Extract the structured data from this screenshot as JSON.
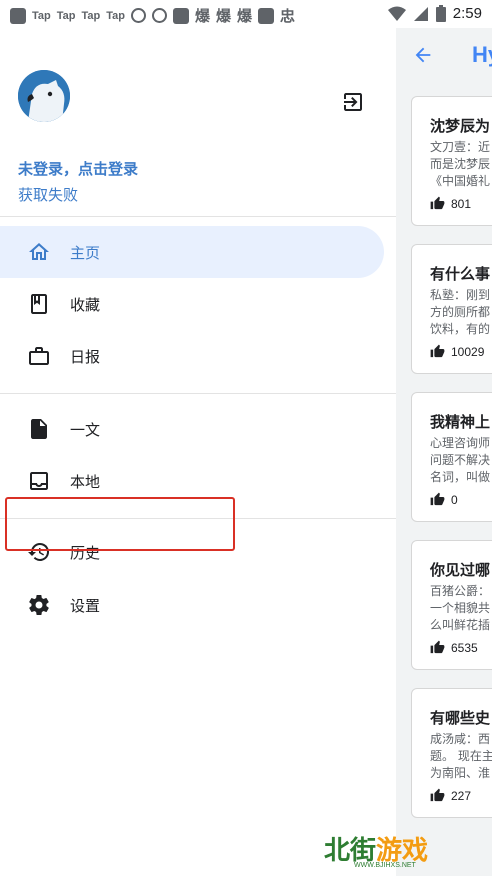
{
  "status_bar": {
    "tap_labels": [
      "Tap",
      "Tap",
      "Tap",
      "Tap"
    ],
    "glyphs": [
      "爆",
      "爆",
      "爆",
      "忠"
    ],
    "time": "2:59"
  },
  "header": {
    "title": "Hy"
  },
  "drawer": {
    "login_text": "未登录，点击登录",
    "login_sub": "获取失败",
    "nav": [
      {
        "label": "主页",
        "icon": "home-icon",
        "active": true
      },
      {
        "label": "收藏",
        "icon": "bookmark-icon",
        "active": false
      },
      {
        "label": "日报",
        "icon": "briefcase-icon",
        "active": false
      },
      {
        "label": "一文",
        "icon": "document-icon",
        "active": false
      },
      {
        "label": "本地",
        "icon": "inbox-icon",
        "active": false
      },
      {
        "label": "历史",
        "icon": "history-icon",
        "active": false
      },
      {
        "label": "设置",
        "icon": "gear-icon",
        "active": false
      }
    ]
  },
  "cards": [
    {
      "title": "沈梦辰为",
      "excerpt": "文刀壹：近\n而是沈梦辰\n《中国婚礼",
      "likes": "801"
    },
    {
      "title": "有什么事",
      "excerpt": "私塾：刚到\n方的厕所都\n饮料，有的",
      "likes": "10029"
    },
    {
      "title": "我精神上",
      "excerpt": "心理咨询师\n问题不解决\n名词，叫做",
      "likes": "0"
    },
    {
      "title": "你见过哪",
      "excerpt": "百猪公爵：\n一个相貌共\n么叫鲜花插",
      "likes": "6535"
    },
    {
      "title": "有哪些史",
      "excerpt": "成汤咸：西\n题。 现在主\n为南阳、淮",
      "likes": "227"
    }
  ],
  "watermark": {
    "text_a": "北街",
    "text_b": "游戏",
    "url": "WWW.BJIHXS.NET"
  },
  "colors": {
    "accent": "#3d7cc9",
    "active_bg": "#e8f0fe",
    "highlight": "#d93025"
  }
}
